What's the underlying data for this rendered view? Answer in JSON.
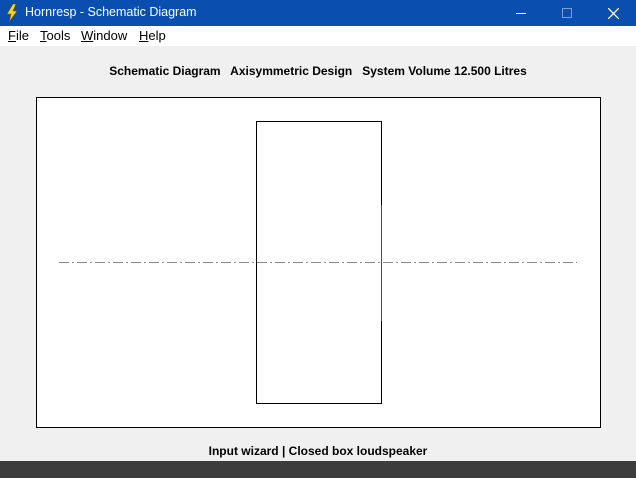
{
  "window": {
    "title": "Hornresp - Schematic Diagram",
    "icon": "lightning-bolt-icon",
    "controls": [
      "minimize-icon",
      "maximize-icon",
      "close-icon"
    ],
    "title_bar_color": "#0a4fb0"
  },
  "menu": {
    "file": {
      "first": "F",
      "rest": "ile"
    },
    "tools": {
      "first": "T",
      "rest": "ools"
    },
    "window": {
      "first": "W",
      "rest": "indow"
    },
    "help": {
      "first": "H",
      "rest": "elp"
    }
  },
  "heading": {
    "diagram": "Schematic Diagram",
    "design": "Axisymmetric Design",
    "volume": "System Volume 12.500 Litres"
  },
  "diagram": {
    "driver_color": "#ff0000",
    "axis_color": "#888888"
  },
  "status": "Input wizard | Closed box loudspeaker"
}
